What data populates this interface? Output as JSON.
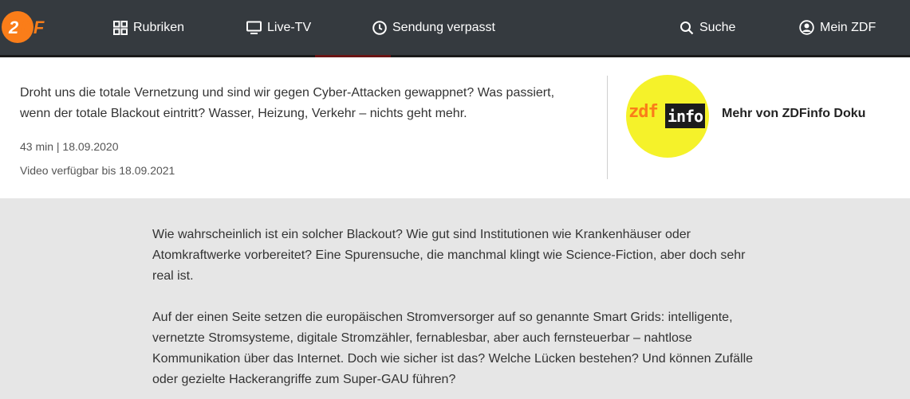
{
  "header": {
    "logo_text": "ZDF",
    "nav": [
      {
        "label": "Rubriken",
        "icon": "grid-icon"
      },
      {
        "label": "Live-TV",
        "icon": "tv-icon"
      },
      {
        "label": "Sendung verpasst",
        "icon": "clock-icon"
      },
      {
        "label": "Suche",
        "icon": "search-icon"
      },
      {
        "label": "Mein ZDF",
        "icon": "user-icon"
      }
    ]
  },
  "info": {
    "teaser": "Droht uns die totale Vernetzung und sind wir gegen Cyber-Attacken gewappnet? Was passiert, wenn der totale Blackout eintritt? Wasser, Heizung, Verkehr – nichts geht mehr.",
    "duration_date": "43 min | 18.09.2020",
    "available": "Video verfügbar bis 18.09.2021",
    "channel_logo_text_left": "zdf",
    "channel_logo_text_right": "info",
    "channel_link": "Mehr von ZDFinfo Doku"
  },
  "description": {
    "paragraphs": [
      "Wie wahrscheinlich ist ein solcher Blackout? Wie gut sind Institutionen wie Krankenhäuser oder Atomkraftwerke vorbereitet? Eine Spurensuche, die manchmal klingt wie Science-Fiction, aber doch sehr real ist.",
      "Auf der einen Seite setzen die europäischen Stromversorger auf so genannte Smart Grids: intelli­gente, vernetzte Stromsysteme, digitale Stromzähler, fernablesbar, aber auch fernsteuerbar – nahtlose Kommunikation über das Internet. Doch wie sicher ist das? Welche Lücken bestehen? Und können Zufälle oder gezielte Hackerangriffe zum Super-GAU führen?"
    ]
  },
  "colors": {
    "header_bg": "#353a3f",
    "brand_orange": "#fa7d19",
    "zdfinfo_yellow": "#f5f22a",
    "page_bg": "#e6e6e6"
  }
}
